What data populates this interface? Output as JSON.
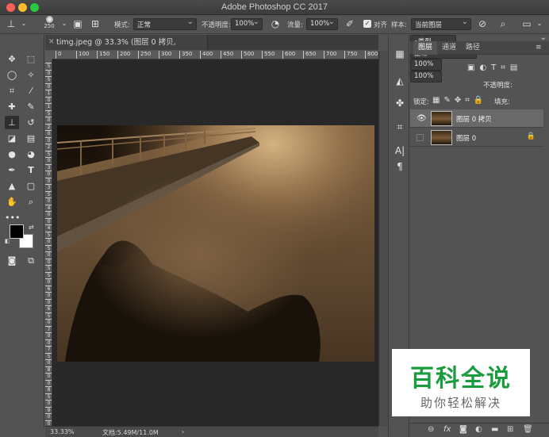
{
  "window": {
    "title": "Adobe Photoshop CC 2017"
  },
  "options_bar": {
    "brush_size": "250",
    "mode_label": "模式:",
    "mode_value": "正常",
    "opacity_label": "不透明度:",
    "opacity_value": "100%",
    "flow_label": "流量:",
    "flow_value": "100%",
    "align_label": "对齐",
    "sample_label": "样本:",
    "sample_value": "当前图层"
  },
  "document": {
    "tab_title": "timg.jpeg @ 33.3% (图层 0 拷贝, RGB/8#) *",
    "ruler_h": [
      "0",
      "100",
      "150",
      "200",
      "250",
      "300",
      "350",
      "400",
      "450",
      "500",
      "550",
      "600",
      "650",
      "700",
      "750",
      "800",
      "850",
      "900",
      "950",
      "1000",
      "1050",
      "1100",
      "1150",
      "1200",
      "1250",
      "1300",
      "1350",
      "1400",
      "1450",
      "1500"
    ],
    "ruler_v": [
      "5",
      "0",
      "5",
      "0",
      "1",
      "0",
      "1",
      "5",
      "0",
      "2",
      "0",
      "0",
      "2",
      "5",
      "0",
      "3",
      "0",
      "0",
      "3",
      "5",
      "0",
      "4",
      "0",
      "0",
      "4",
      "5",
      "0",
      "5",
      "0",
      "0",
      "5",
      "5",
      "0",
      "6",
      "0",
      "0",
      "6",
      "5",
      "0",
      "7",
      "0",
      "0",
      "7",
      "5",
      "0",
      "8",
      "0",
      "0",
      "8",
      "5",
      "0",
      "9",
      "0",
      "0"
    ]
  },
  "status_bar": {
    "zoom": "33.33%",
    "doc_info": "文档:5.49M/11.0M"
  },
  "layers_panel": {
    "tabs": [
      "图层",
      "通道",
      "路径"
    ],
    "filter_kind": "类型",
    "blend_mode": "正常",
    "opacity_label": "不透明度:",
    "opacity_value": "100%",
    "lock_label": "锁定:",
    "fill_label": "填充:",
    "fill_value": "100%",
    "layers": [
      {
        "name": "图层 0 拷贝",
        "visible": true,
        "selected": true
      },
      {
        "name": "图层 0",
        "visible": false,
        "selected": false,
        "locked": true
      }
    ]
  },
  "watermark": {
    "title": "百科全说",
    "subtitle": "助你轻松解决"
  },
  "colors": {
    "foreground": "#000000",
    "background": "#ffffff",
    "accent": "#1a9b3d"
  }
}
